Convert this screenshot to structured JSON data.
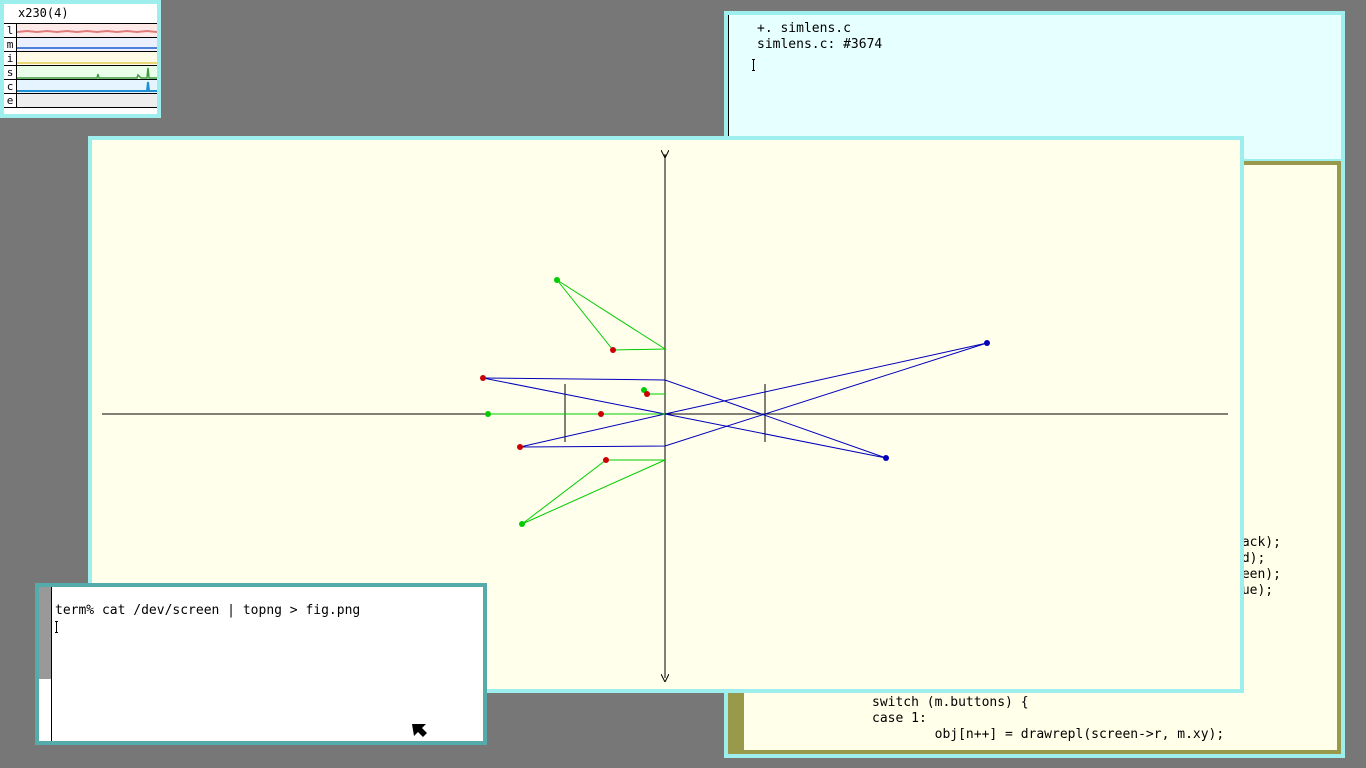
{
  "stats": {
    "title": "x230(4)",
    "rows": [
      {
        "label": "l",
        "color": "#e07b7b"
      },
      {
        "label": "m",
        "color": "#4f7fd6"
      },
      {
        "label": "i",
        "color": "#e8d87a"
      },
      {
        "label": "s",
        "color": "#3f9a3f"
      },
      {
        "label": "c",
        "color": "#1f8fd6"
      },
      {
        "label": "e",
        "color": "#eeeeee"
      }
    ]
  },
  "acme": {
    "tag_line1": "+. simlens.c",
    "tag_line2": "simlens.c: #3674",
    "partial_lines": [
      "lack);",
      "ed);",
      "reen);",
      "lue);"
    ],
    "bottom_lines": [
      "switch (m.buttons) {",
      "case 1:",
      "        obj[n++] = drawrepl(screen->r, m.xy);"
    ]
  },
  "terminal": {
    "command": "term% cat /dev/screen | topng > fig.png"
  },
  "plot": {
    "colors": {
      "axis": "#000000",
      "blue": "#0000bb",
      "green": "#00cc00",
      "red": "#cc0000"
    }
  }
}
